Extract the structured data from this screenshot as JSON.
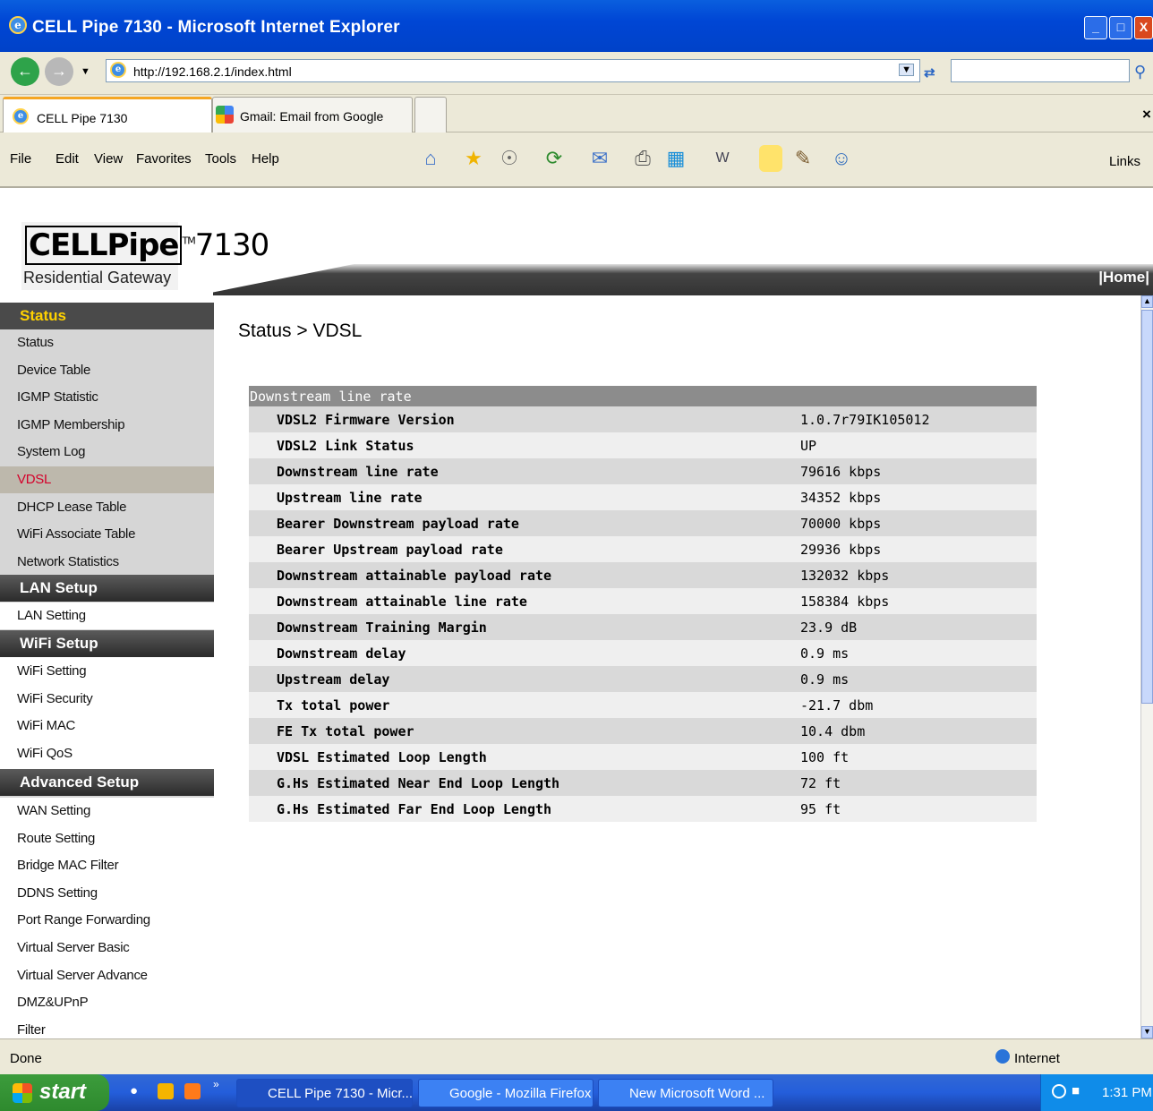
{
  "window": {
    "title": "CELL Pipe 7130 - Microsoft Internet Explorer",
    "min": "_",
    "max": "□",
    "close": "X"
  },
  "address": {
    "url": "http://192.168.2.1/index.html"
  },
  "tabs": [
    {
      "label": "CELL Pipe 7130"
    },
    {
      "label": "Gmail: Email from Google"
    }
  ],
  "menu": [
    "File",
    "Edit",
    "View",
    "Favorites",
    "Tools",
    "Help"
  ],
  "links_label": "Links",
  "logo": {
    "brand": "CELLPipe",
    "tm": "TM",
    "model": "7130",
    "subtitle": "Residential Gateway"
  },
  "home_link": "|Home|",
  "sidebar": {
    "status_title": "Status",
    "status_items": [
      "Status",
      "Device Table",
      "IGMP Statistic",
      "IGMP Membership",
      "System Log",
      "VDSL",
      "DHCP Lease Table",
      "WiFi Associate Table",
      "Network Statistics"
    ],
    "lan_title": "LAN Setup",
    "lan_items": [
      "LAN Setting"
    ],
    "wifi_title": "WiFi Setup",
    "wifi_items": [
      "WiFi Setting",
      "WiFi Security",
      "WiFi MAC",
      "WiFi QoS"
    ],
    "adv_title": "Advanced Setup",
    "adv_items": [
      "WAN Setting",
      "Route Setting",
      "Bridge MAC Filter",
      "DDNS Setting",
      "Port Range Forwarding",
      "Virtual Server Basic",
      "Virtual Server Advance",
      "DMZ&UPnP",
      "Filter"
    ]
  },
  "breadcrumb": "Status > VDSL",
  "table": {
    "header": "Downstream line rate",
    "rows": [
      {
        "label": "VDSL2 Firmware Version",
        "value": "1.0.7r79IK105012"
      },
      {
        "label": "VDSL2 Link Status",
        "value": "UP"
      },
      {
        "label": "Downstream line rate",
        "value": "79616 kbps"
      },
      {
        "label": "Upstream line rate",
        "value": "34352 kbps"
      },
      {
        "label": "Bearer Downstream payload rate",
        "value": "70000 kbps"
      },
      {
        "label": "Bearer Upstream payload rate",
        "value": "29936 kbps"
      },
      {
        "label": "Downstream attainable payload rate",
        "value": "132032 kbps"
      },
      {
        "label": "Downstream attainable line rate",
        "value": "158384 kbps"
      },
      {
        "label": "Downstream Training Margin",
        "value": "23.9 dB"
      },
      {
        "label": "Downstream delay",
        "value": "0.9 ms"
      },
      {
        "label": "Upstream delay",
        "value": "0.9 ms"
      },
      {
        "label": "Tx total power",
        "value": "-21.7 dbm"
      },
      {
        "label": "FE Tx total power",
        "value": "10.4 dbm"
      },
      {
        "label": "VDSL Estimated Loop Length",
        "value": "100 ft"
      },
      {
        "label": "G.Hs Estimated Near End Loop Length",
        "value": "72 ft"
      },
      {
        "label": "G.Hs Estimated Far End Loop Length",
        "value": "95 ft"
      }
    ]
  },
  "status": {
    "left": "Done",
    "zone": "Internet"
  },
  "taskbar": {
    "start": "start",
    "tasks": [
      "CELL Pipe 7130 - Micr...",
      "Google - Mozilla Firefox",
      "New Microsoft Word ..."
    ],
    "time": "1:31 PM"
  }
}
